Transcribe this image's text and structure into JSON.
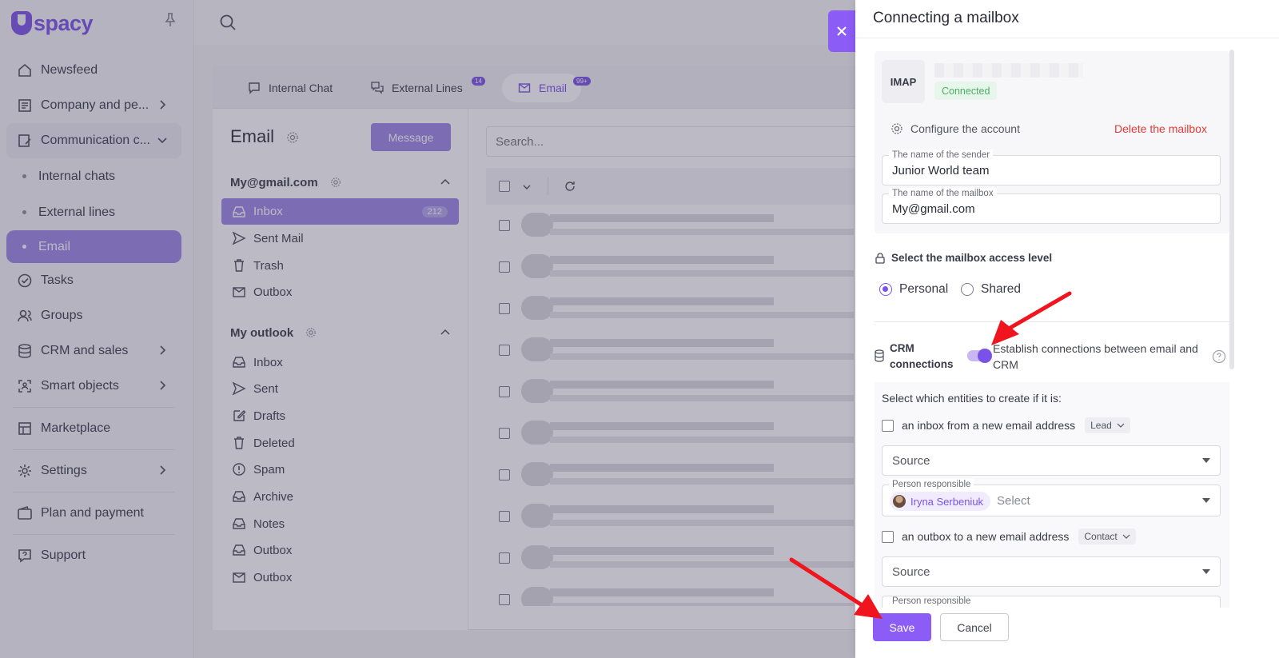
{
  "brand": {
    "name": "spacy"
  },
  "sidebar": {
    "items": [
      {
        "label": "Newsfeed"
      },
      {
        "label": "Company and pe..."
      },
      {
        "label": "Communication c..."
      },
      {
        "label": "Tasks"
      },
      {
        "label": "Groups"
      },
      {
        "label": "CRM and sales"
      },
      {
        "label": "Smart objects"
      },
      {
        "label": "Marketplace"
      },
      {
        "label": "Settings"
      },
      {
        "label": "Plan and payment"
      },
      {
        "label": "Support"
      }
    ],
    "sub_items": [
      {
        "label": "Internal chats"
      },
      {
        "label": "External lines"
      },
      {
        "label": "Email"
      }
    ]
  },
  "tabs": [
    {
      "label": "Internal Chat",
      "badge": ""
    },
    {
      "label": "External Lines",
      "badge": "14"
    },
    {
      "label": "Email",
      "badge": "99+"
    }
  ],
  "email": {
    "title": "Email",
    "message_button": "Message",
    "search_placeholder": "Search...",
    "account1": {
      "name": "My@gmail.com",
      "folders": [
        {
          "label": "Inbox",
          "count": "212"
        },
        {
          "label": "Sent Mail"
        },
        {
          "label": "Trash"
        },
        {
          "label": "Outbox"
        }
      ]
    },
    "account2": {
      "name": "My outlook",
      "folders": [
        {
          "label": "Inbox"
        },
        {
          "label": "Sent"
        },
        {
          "label": "Drafts"
        },
        {
          "label": "Deleted"
        },
        {
          "label": "Spam"
        },
        {
          "label": "Archive"
        },
        {
          "label": "Notes"
        },
        {
          "label": "Outbox"
        },
        {
          "label": "Outbox"
        }
      ]
    }
  },
  "drawer": {
    "title": "Connecting a mailbox",
    "protocol": "IMAP",
    "status": "Connected",
    "configure": "Configure the account",
    "delete": "Delete the mailbox",
    "sender_label": "The name of the sender",
    "sender_value": "Junior World team",
    "mailbox_label": "The name of the mailbox",
    "mailbox_value": "My@gmail.com",
    "access_label": "Select the mailbox access level",
    "access_personal": "Personal",
    "access_shared": "Shared",
    "crm_label": "CRM connections",
    "crm_desc": "Establish connections between email and CRM",
    "entities_label": "Select which entities to create if it is:",
    "inbox_rule": "an inbox from a new email address",
    "inbox_entity": "Lead",
    "source_placeholder": "Source",
    "person_label": "Person responsible",
    "person_name": "Iryna Serbeniuk",
    "select_placeholder": "Select",
    "outbox_rule": "an outbox to a new email address",
    "outbox_entity": "Contact",
    "save": "Save",
    "cancel": "Cancel"
  },
  "colors": {
    "accent": "#8b5cf6",
    "danger": "#e53935",
    "success": "#4caf62",
    "arrow": "#f0141e"
  }
}
